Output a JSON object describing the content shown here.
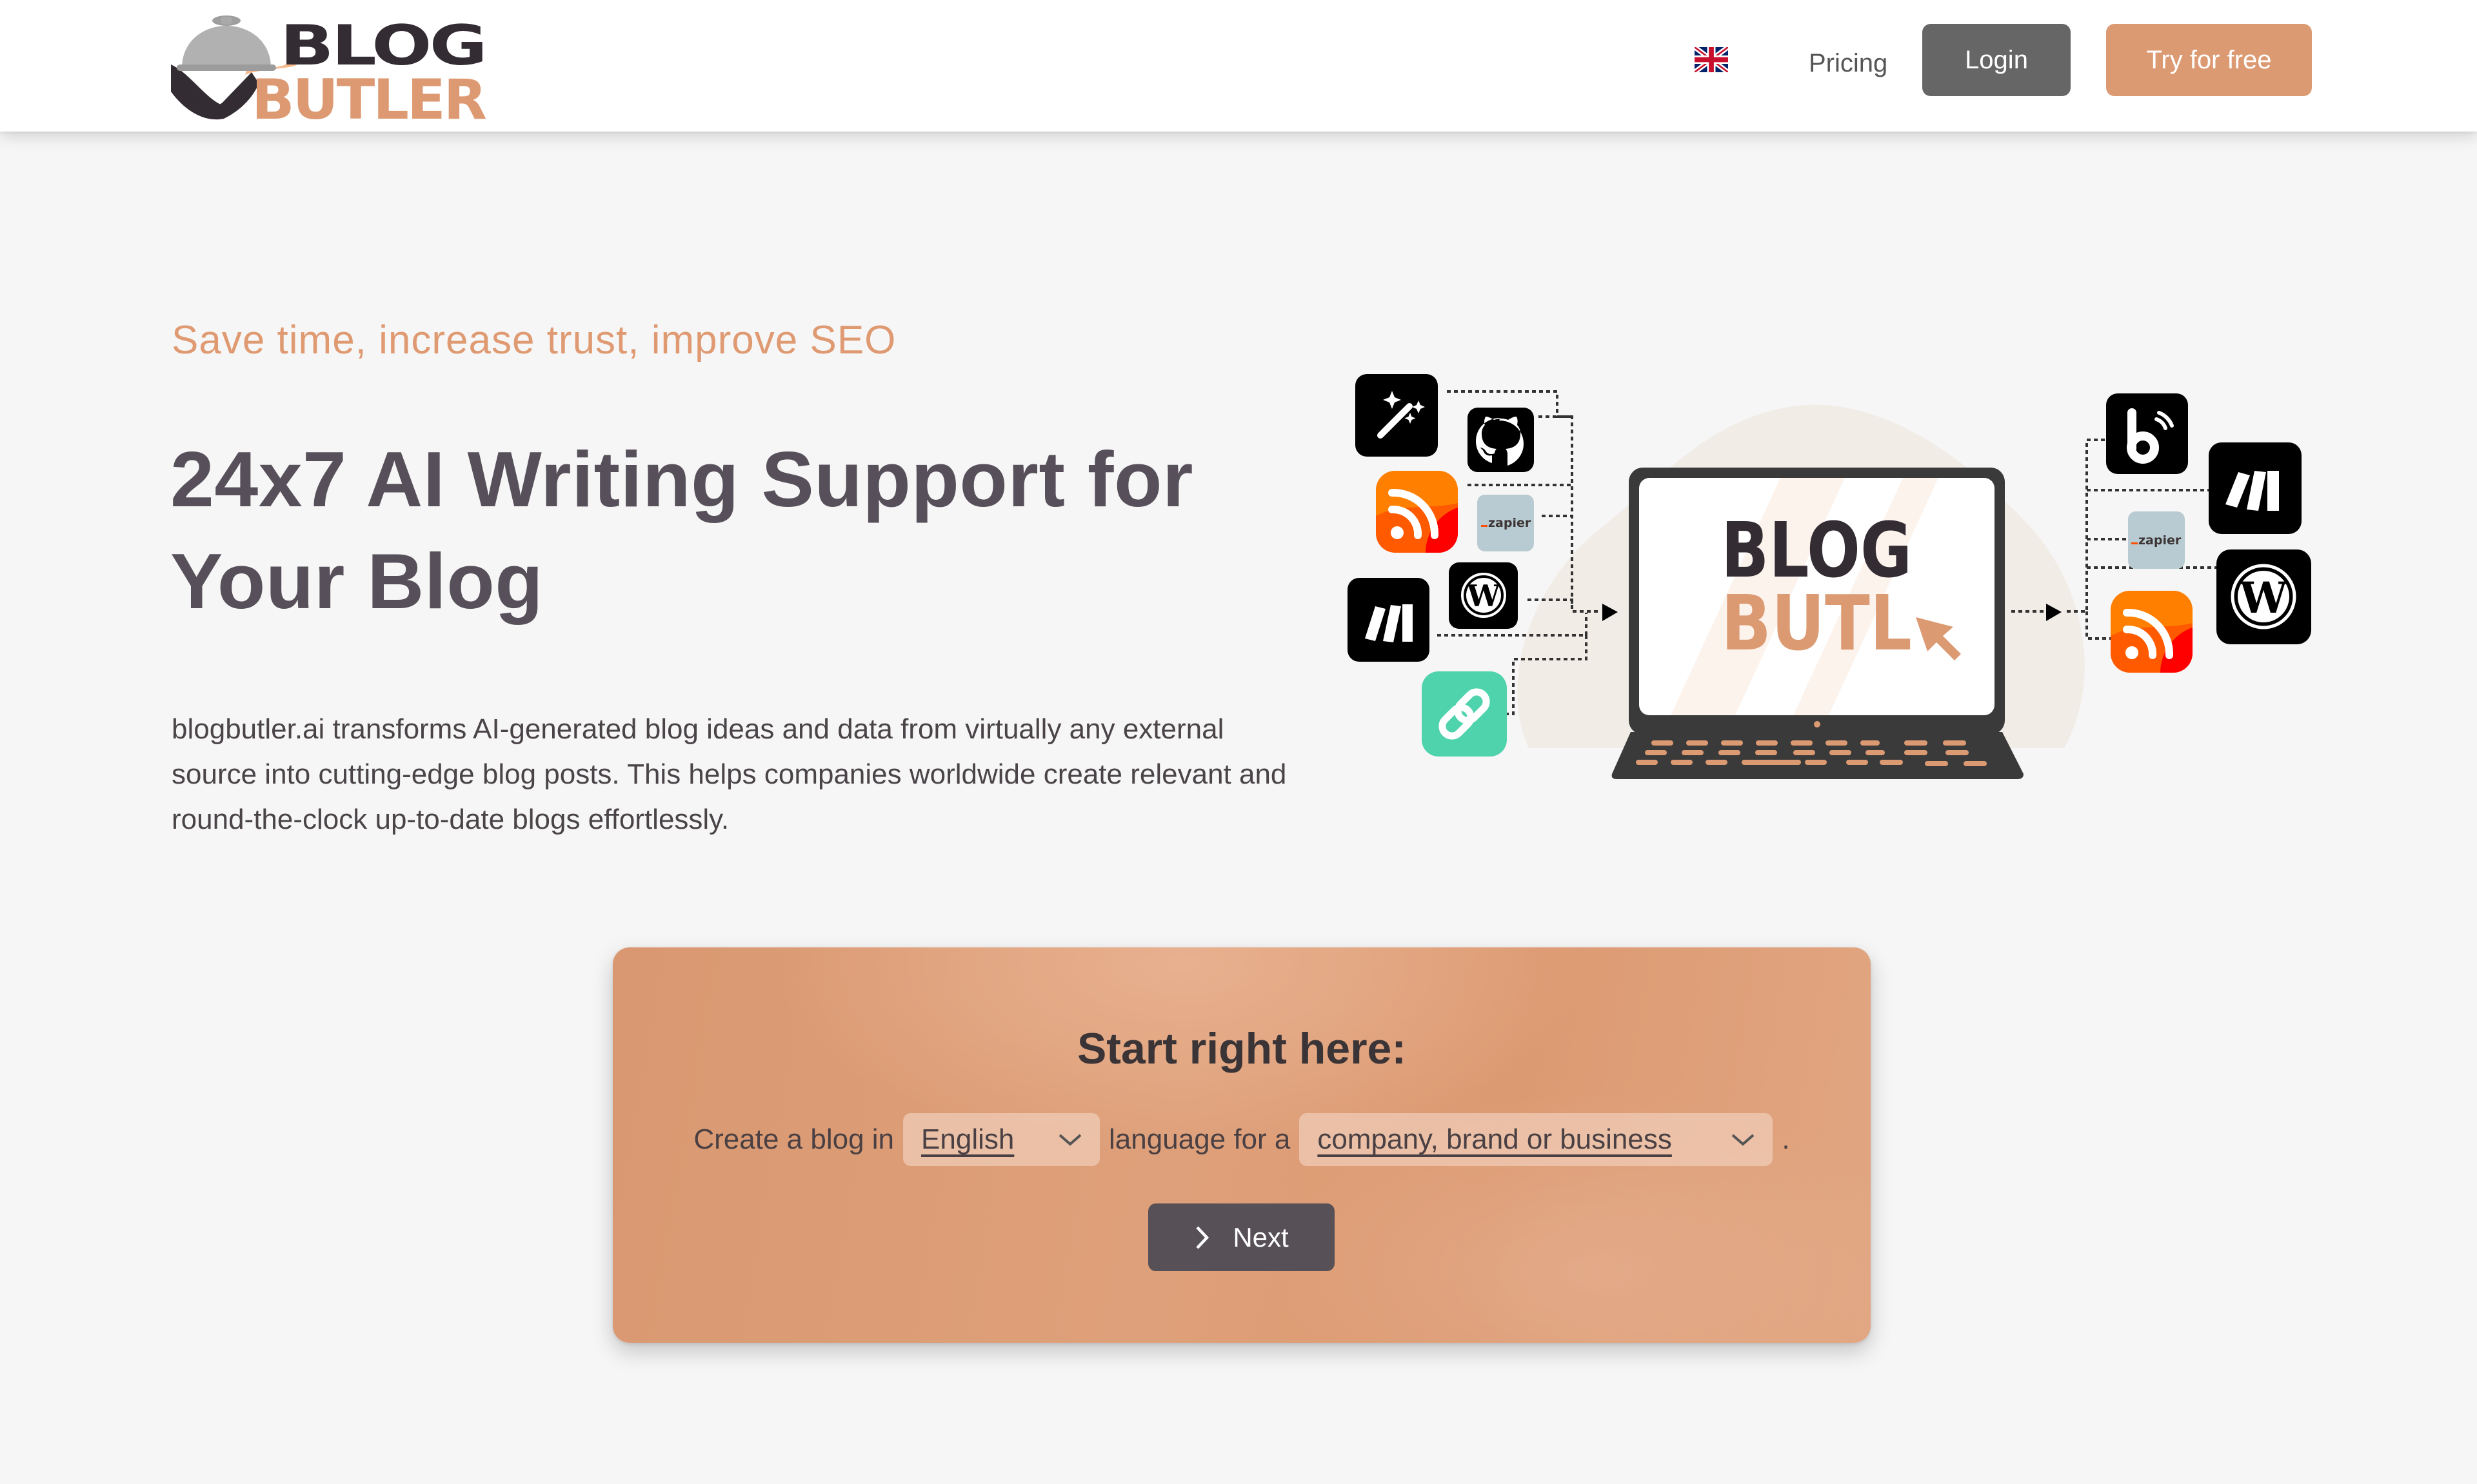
{
  "header": {
    "logo": {
      "top": "BLOG",
      "bottom": "BUTLER",
      "icon": "butler-cloche-icon"
    },
    "language_flag": "uk-flag-icon",
    "nav": [
      {
        "label": "Pricing"
      }
    ],
    "login_label": "Login",
    "try_label": "Try for free"
  },
  "hero": {
    "kicker": "Save time, increase trust, improve SEO",
    "headline": "24x7 AI Writing Support for Your Blog",
    "lead": "blogbutler.ai transforms AI-generated blog ideas and data from virtually any external source into cutting-edge blog posts. This helps companies worldwide create relevant and round-the-clock up-to-date blogs effortlessly."
  },
  "illustration": {
    "screen_text_top": "BLOG",
    "screen_text_bottom": "BUTL",
    "inputs": [
      "magic-wand",
      "github",
      "rss",
      "zapier",
      "wordpress",
      "make",
      "link"
    ],
    "outputs": [
      "blogger",
      "make",
      "zapier",
      "wordpress",
      "rss"
    ],
    "zapier_label": "zapier"
  },
  "cta": {
    "title": "Start right here:",
    "sentence_prefix": "Create a blog in",
    "language_value": "English",
    "sentence_middle": "language for a",
    "type_value": "company, brand or business",
    "sentence_suffix": ".",
    "next_label": "Next"
  },
  "colors": {
    "brand_orange": "#dc9a72",
    "brand_dark": "#57505a",
    "login_gray": "#666666",
    "page_bg": "#f6f6f6"
  }
}
